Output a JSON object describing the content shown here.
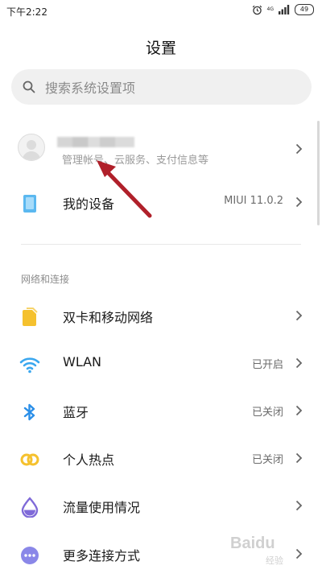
{
  "status_bar": {
    "time": "下午2:22",
    "network": "4G",
    "battery": "49"
  },
  "page": {
    "title": "设置"
  },
  "search": {
    "placeholder": "搜索系统设置项"
  },
  "account": {
    "subtitle": "管理帐号、云服务、支付信息等"
  },
  "my_device": {
    "label": "我的设备",
    "value": "MIUI 11.0.2"
  },
  "section": {
    "network_header": "网络和连接"
  },
  "network_items": [
    {
      "label": "双卡和移动网络",
      "value": ""
    },
    {
      "label": "WLAN",
      "value": "已开启"
    },
    {
      "label": "蓝牙",
      "value": "已关闭"
    },
    {
      "label": "个人热点",
      "value": "已关闭"
    },
    {
      "label": "流量使用情况",
      "value": ""
    },
    {
      "label": "更多连接方式",
      "value": ""
    }
  ],
  "watermark": {
    "brand": "Baidu",
    "sub": "经验"
  },
  "colors": {
    "device_icon": "#5bb8f0",
    "sim_icon": "#f5c12e",
    "wifi_icon": "#3aa7ef",
    "bluetooth_icon": "#2b8fe8",
    "hotspot_icon": "#f5c12e",
    "data_usage_icon": "#7f6ad8",
    "more_icon": "#8a87e8",
    "annotation_arrow": "#b0202a"
  }
}
